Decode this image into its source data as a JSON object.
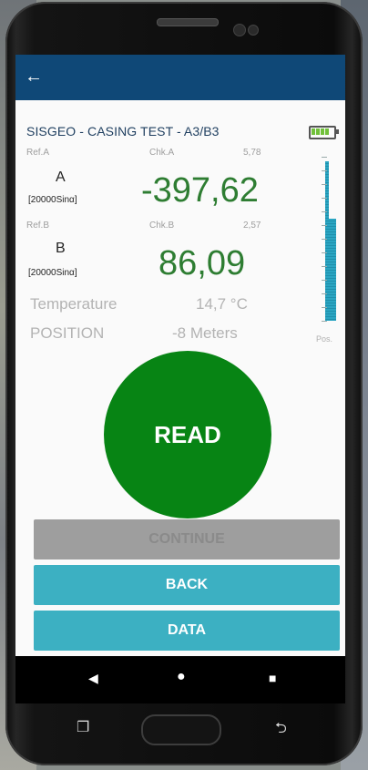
{
  "header": {
    "back_icon": "arrow-left-icon"
  },
  "title": "SISGEO - CASING TEST - A3/B3",
  "battery": {
    "icon": "battery-icon",
    "level": 1.0
  },
  "channel_a": {
    "ref_label": "Ref.A",
    "chk_label": "Chk.A",
    "chk_value": "5,78",
    "letter": "A",
    "unit": "[20000Sinα]",
    "reading": "-397,62"
  },
  "channel_b": {
    "ref_label": "Ref.B",
    "chk_label": "Chk.B",
    "chk_value": "2,57",
    "letter": "B",
    "unit": "[20000Sinα]",
    "reading": "86,09"
  },
  "temperature": {
    "label": "Temperature",
    "value": "14,7 °C"
  },
  "position": {
    "label": "POSITION",
    "value": "-8 Meters"
  },
  "gauge": {
    "label": "Pos.",
    "bar1_fill": 0.97,
    "bar2_fill": 0.62
  },
  "buttons": {
    "read": "READ",
    "continue": "CONTINUE",
    "back": "BACK",
    "data": "DATA"
  },
  "nav": {
    "back_icon": "triangle-back-icon",
    "home_icon": "circle-home-icon",
    "recents_icon": "square-recents-icon"
  },
  "colors": {
    "appbar": "#0f4877",
    "reading": "#2e7d32",
    "read_button": "#078414",
    "action_button": "#3cb0c2",
    "disabled_button": "#9e9e9e"
  }
}
